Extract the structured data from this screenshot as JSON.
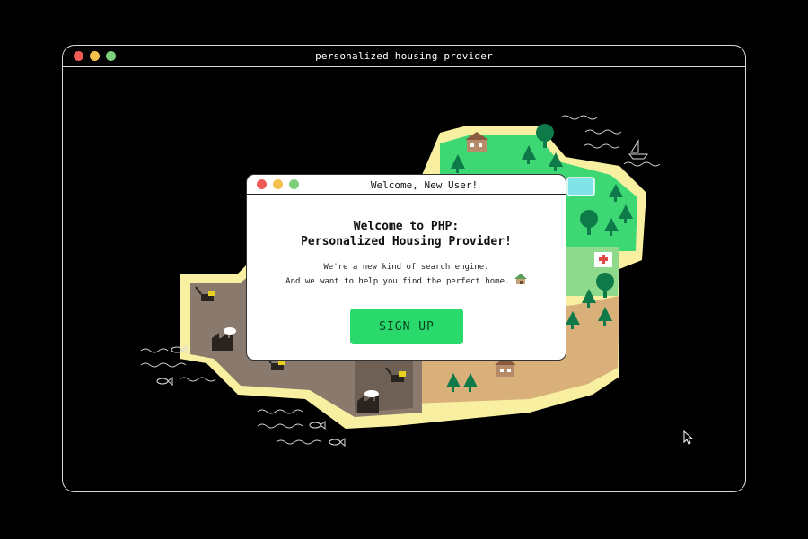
{
  "window": {
    "title": "personalized housing provider"
  },
  "modal": {
    "title": "Welcome, New User!",
    "heading_line1": "Welcome to PHP:",
    "heading_line2": "Personalized Housing Provider!",
    "body_line1": "We're a new kind of search engine.",
    "body_line2": "And we want to help you find the perfect home.",
    "signup_label": "SIGN UP"
  },
  "colors": {
    "close": "#ee5a56",
    "minimize": "#f5c04e",
    "maximize": "#7fd07a",
    "signup": "#2ad96b",
    "sand_border": "#f8f0a0",
    "grass": "#3dd873",
    "industrial": "#8a7a6d",
    "desert": "#d9b07a"
  },
  "icons": [
    "close-dot",
    "minimize-dot",
    "maximize-dot",
    "house-icon",
    "mouse-cursor-icon"
  ]
}
